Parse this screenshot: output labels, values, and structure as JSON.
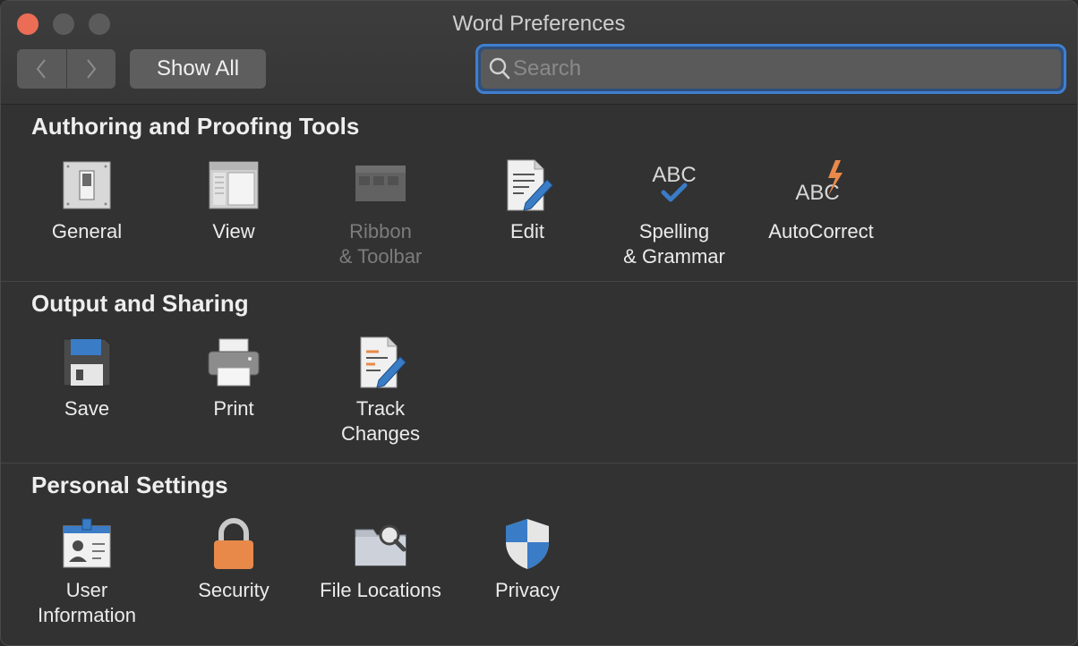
{
  "window": {
    "title": "Word Preferences",
    "toolbar": {
      "back_icon": "chevron-left-icon",
      "forward_icon": "chevron-right-icon",
      "show_all_label": "Show All",
      "search_placeholder": "Search",
      "search_value": ""
    }
  },
  "sections": [
    {
      "title": "Authoring and Proofing Tools",
      "items": [
        {
          "label": "General",
          "icon": "general-switch-icon"
        },
        {
          "label": "View",
          "icon": "view-window-icon"
        },
        {
          "label": "Ribbon\n& Toolbar",
          "icon": "ribbon-toolbar-icon",
          "disabled": true
        },
        {
          "label": "Edit",
          "icon": "edit-document-icon"
        },
        {
          "label": "Spelling\n& Grammar",
          "icon": "abc-check-icon"
        },
        {
          "label": "AutoCorrect",
          "icon": "abc-lightning-icon"
        }
      ]
    },
    {
      "title": "Output and Sharing",
      "items": [
        {
          "label": "Save",
          "icon": "floppy-disk-icon"
        },
        {
          "label": "Print",
          "icon": "printer-icon"
        },
        {
          "label": "Track\nChanges",
          "icon": "track-changes-icon"
        }
      ]
    },
    {
      "title": "Personal Settings",
      "items": [
        {
          "label": "User\nInformation",
          "icon": "id-badge-icon"
        },
        {
          "label": "Security",
          "icon": "padlock-icon"
        },
        {
          "label": "File Locations",
          "icon": "folder-search-icon"
        },
        {
          "label": "Privacy",
          "icon": "shield-icon"
        }
      ]
    }
  ],
  "colors": {
    "close": "#ec6d56",
    "focus_ring": "#3f7fd0",
    "accent_blue": "#3a7cc6",
    "accent_orange": "#e8894a"
  }
}
